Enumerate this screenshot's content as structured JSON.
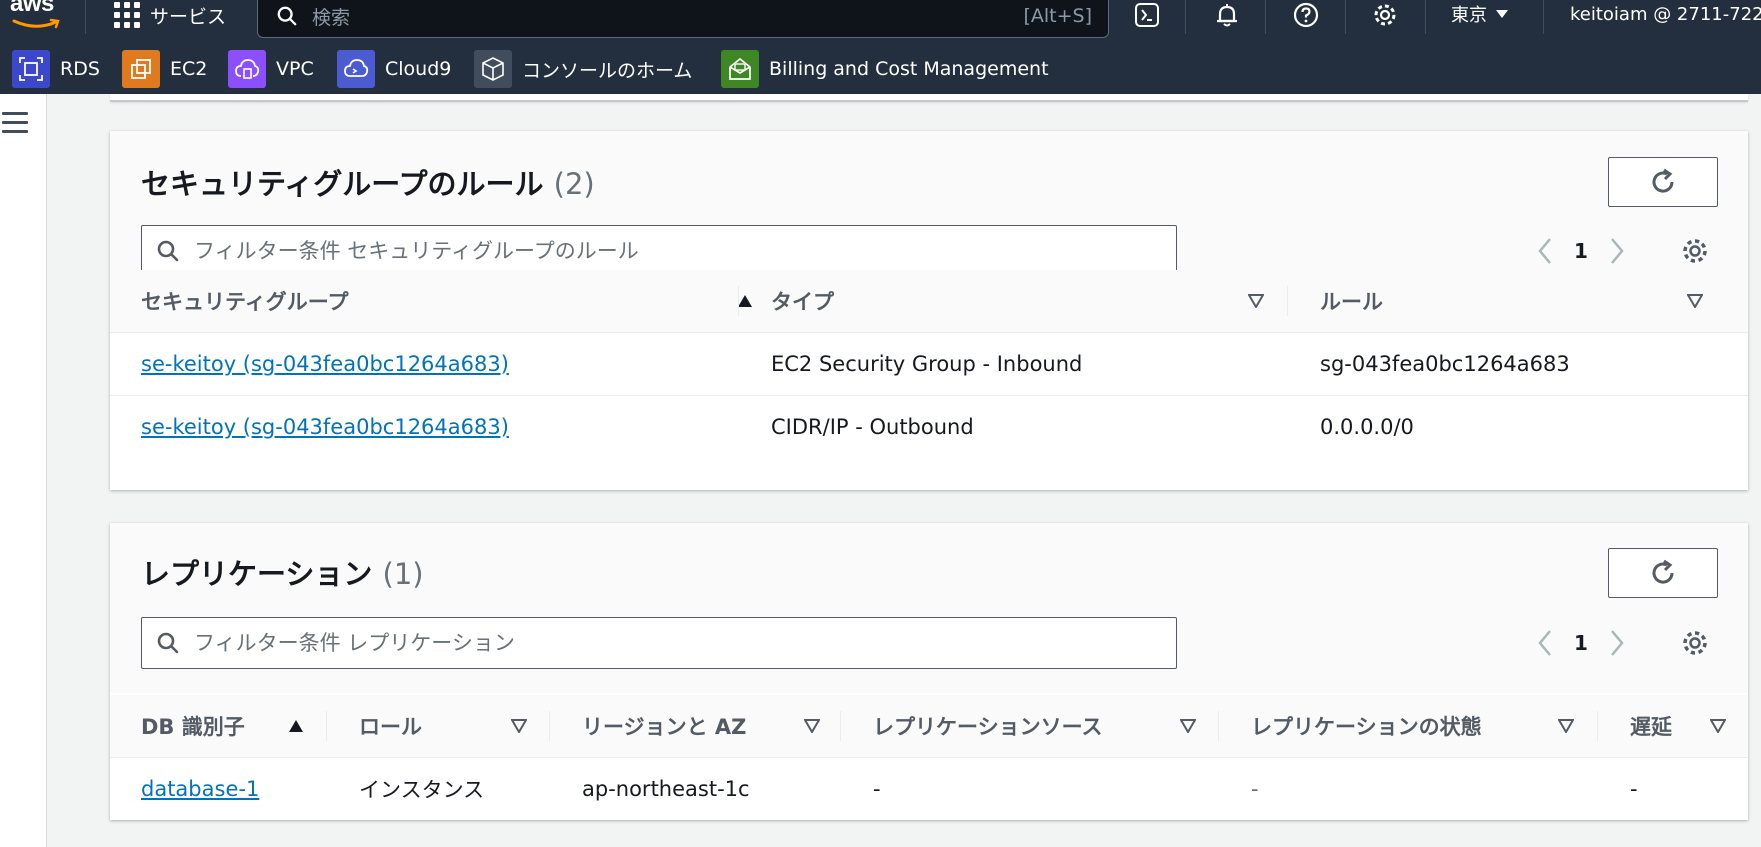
{
  "nav": {
    "logo": "aws",
    "services_label": "サービス",
    "search_placeholder": "検索",
    "search_shortcut": "[Alt+S]",
    "region": "東京",
    "account": "keitoiam @ 2711-722"
  },
  "favorites": [
    {
      "label": "RDS",
      "color": "#3b48cc"
    },
    {
      "label": "EC2",
      "color": "#e07a1f"
    },
    {
      "label": "VPC",
      "color": "#8c4fff"
    },
    {
      "label": "Cloud9",
      "color": "#4d5bd1"
    },
    {
      "label": "コンソールのホーム",
      "color": "#414d5c"
    },
    {
      "label": "Billing and Cost Management",
      "color": "#3f8624"
    }
  ],
  "sg_rules": {
    "title": "セキュリティグループのルール",
    "count": "(2)",
    "filter_placeholder": "フィルター条件 セキュリティグループのルール",
    "page": "1",
    "columns": [
      "セキュリティグループ",
      "タイプ",
      "ルール"
    ],
    "rows": [
      [
        "se-keitoy (sg-043fea0bc1264a683)",
        "EC2 Security Group - Inbound",
        "sg-043fea0bc1264a683"
      ],
      [
        "se-keitoy (sg-043fea0bc1264a683)",
        "CIDR/IP - Outbound",
        "0.0.0.0/0"
      ]
    ]
  },
  "replication": {
    "title": "レプリケーション",
    "count": "(1)",
    "filter_placeholder": "フィルター条件 レプリケーション",
    "page": "1",
    "columns": [
      "DB 識別子",
      "ロール",
      "リージョンと AZ",
      "レプリケーションソース",
      "レプリケーションの状態",
      "遅延"
    ],
    "rows": [
      [
        "database-1",
        "インスタンス",
        "ap-northeast-1c",
        "-",
        "-",
        "-"
      ]
    ]
  }
}
